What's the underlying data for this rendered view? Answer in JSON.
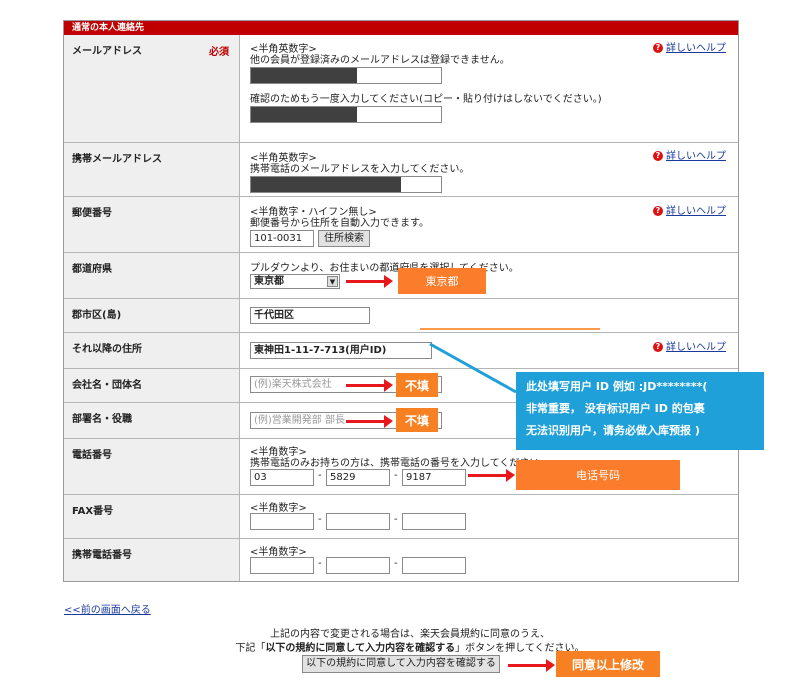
{
  "section": {
    "title": "通常の本人連絡先"
  },
  "help_label": "詳しいヘルプ",
  "email": {
    "label": "メールアドレス",
    "required": "必須",
    "hint1": "<半角英数字>",
    "hint2": "他の会員が登録済みのメールアドレスは登録できません。",
    "confirm_hint": "確認のためもう一度入力してください(コピー・貼り付けはしないでください。)"
  },
  "mobile_email": {
    "label": "携帯メールアドレス",
    "hint1": "<半角英数字>",
    "hint2": "携帯電話のメールアドレスを入力してください。"
  },
  "postal": {
    "label": "郵便番号",
    "hint1": "<半角数字・ハイフン無し>",
    "hint2": "郵便番号から住所を自動入力できます。",
    "value": "101-0031",
    "search_button": "住所検索"
  },
  "prefecture": {
    "label": "都道府県",
    "hint": "プルダウンより、お住まいの都道府県を選択してください。",
    "value": "東京都"
  },
  "city": {
    "label": "郡市区(島)",
    "value": "千代田区"
  },
  "address": {
    "label": "それ以降の住所",
    "value": "東神田1-11-7-713(用户ID)"
  },
  "company": {
    "label": "会社名・団体名",
    "placeholder": "(例)楽天株式会社"
  },
  "department": {
    "label": "部署名・役職",
    "placeholder": "(例)営業開発部 部長"
  },
  "phone": {
    "label": "電話番号",
    "hint1": "<半角数字>",
    "hint2": "携帯電話のみお持ちの方は、携帯電話の番号を入力してください。",
    "part1": "03",
    "part2": "5829",
    "part3": "9187",
    "sep": "-"
  },
  "fax": {
    "label": "FAX番号",
    "hint": "<半角数字>"
  },
  "mobile_phone": {
    "label": "携帯電話番号",
    "hint": "<半角数字>"
  },
  "back_link": "<<前の画面へ戻る",
  "footer": {
    "line1": "上記の内容で変更される場合は、楽天会員規約に同意のうえ、",
    "line2_pre": "下記「",
    "line2_bold": "以下の規約に同意して入力内容を確認する",
    "line2_post": "」ボタンを押してください。",
    "confirm_button": "以下の規約に同意して入力内容を確認する"
  },
  "annotations": {
    "prefecture": "東京都",
    "company": "不填",
    "department": "不填",
    "phone": "电话号码",
    "agree": "同意以上修改",
    "blue_line1": "此处填写用户 ID 例如 :JD********(",
    "blue_line2": "非常重要， 没有标识用户 ID 的包裹",
    "blue_line3": "无法识别用户，请务必做入库预报 )"
  },
  "colors": {
    "section_bar": "#c00000",
    "annotation_orange": "#f78122",
    "annotation_blue": "#1fa0d8",
    "arrow_red": "#e8191d",
    "link_blue": "#1a3a9c"
  }
}
